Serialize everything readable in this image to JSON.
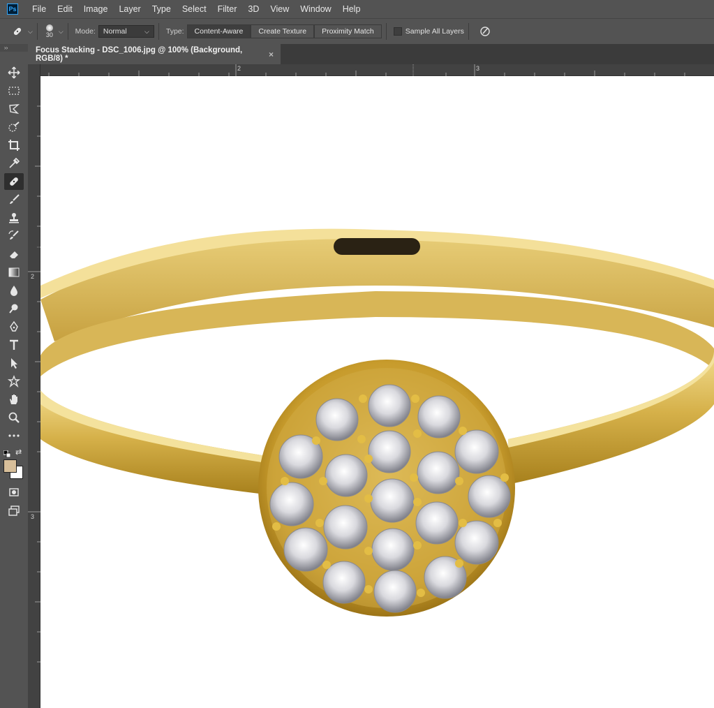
{
  "app": {
    "logo_text": "Ps"
  },
  "menu": [
    "File",
    "Edit",
    "Image",
    "Layer",
    "Type",
    "Select",
    "Filter",
    "3D",
    "View",
    "Window",
    "Help"
  ],
  "options": {
    "brush_size": "30",
    "mode_label": "Mode:",
    "mode_value": "Normal",
    "type_label": "Type:",
    "type_buttons": [
      "Content-Aware",
      "Create Texture",
      "Proximity Match"
    ],
    "sample_all_layers": "Sample All Layers"
  },
  "document": {
    "tab_title": "Focus Stacking - DSC_1006.jpg @ 100% (Background, RGB/8) *",
    "close": "×"
  },
  "rulers": {
    "top": [
      "2",
      "3"
    ],
    "left": [
      "2",
      "3"
    ]
  },
  "toolbar": {
    "collapse": "››",
    "tools": [
      "move-tool",
      "marquee-tool",
      "lasso-tool",
      "quick-selection-tool",
      "crop-tool",
      "eyedropper-tool",
      "spot-healing-brush-tool",
      "brush-tool",
      "clone-stamp-tool",
      "history-brush-tool",
      "eraser-tool",
      "gradient-tool",
      "blur-tool",
      "dodge-tool",
      "pen-tool",
      "type-tool",
      "path-selection-tool",
      "shape-tool",
      "hand-tool",
      "zoom-tool",
      "more-tools"
    ],
    "active_tool": "spot-healing-brush-tool",
    "foreground_color": "#d8bf9a",
    "background_color": "#ffffff"
  }
}
